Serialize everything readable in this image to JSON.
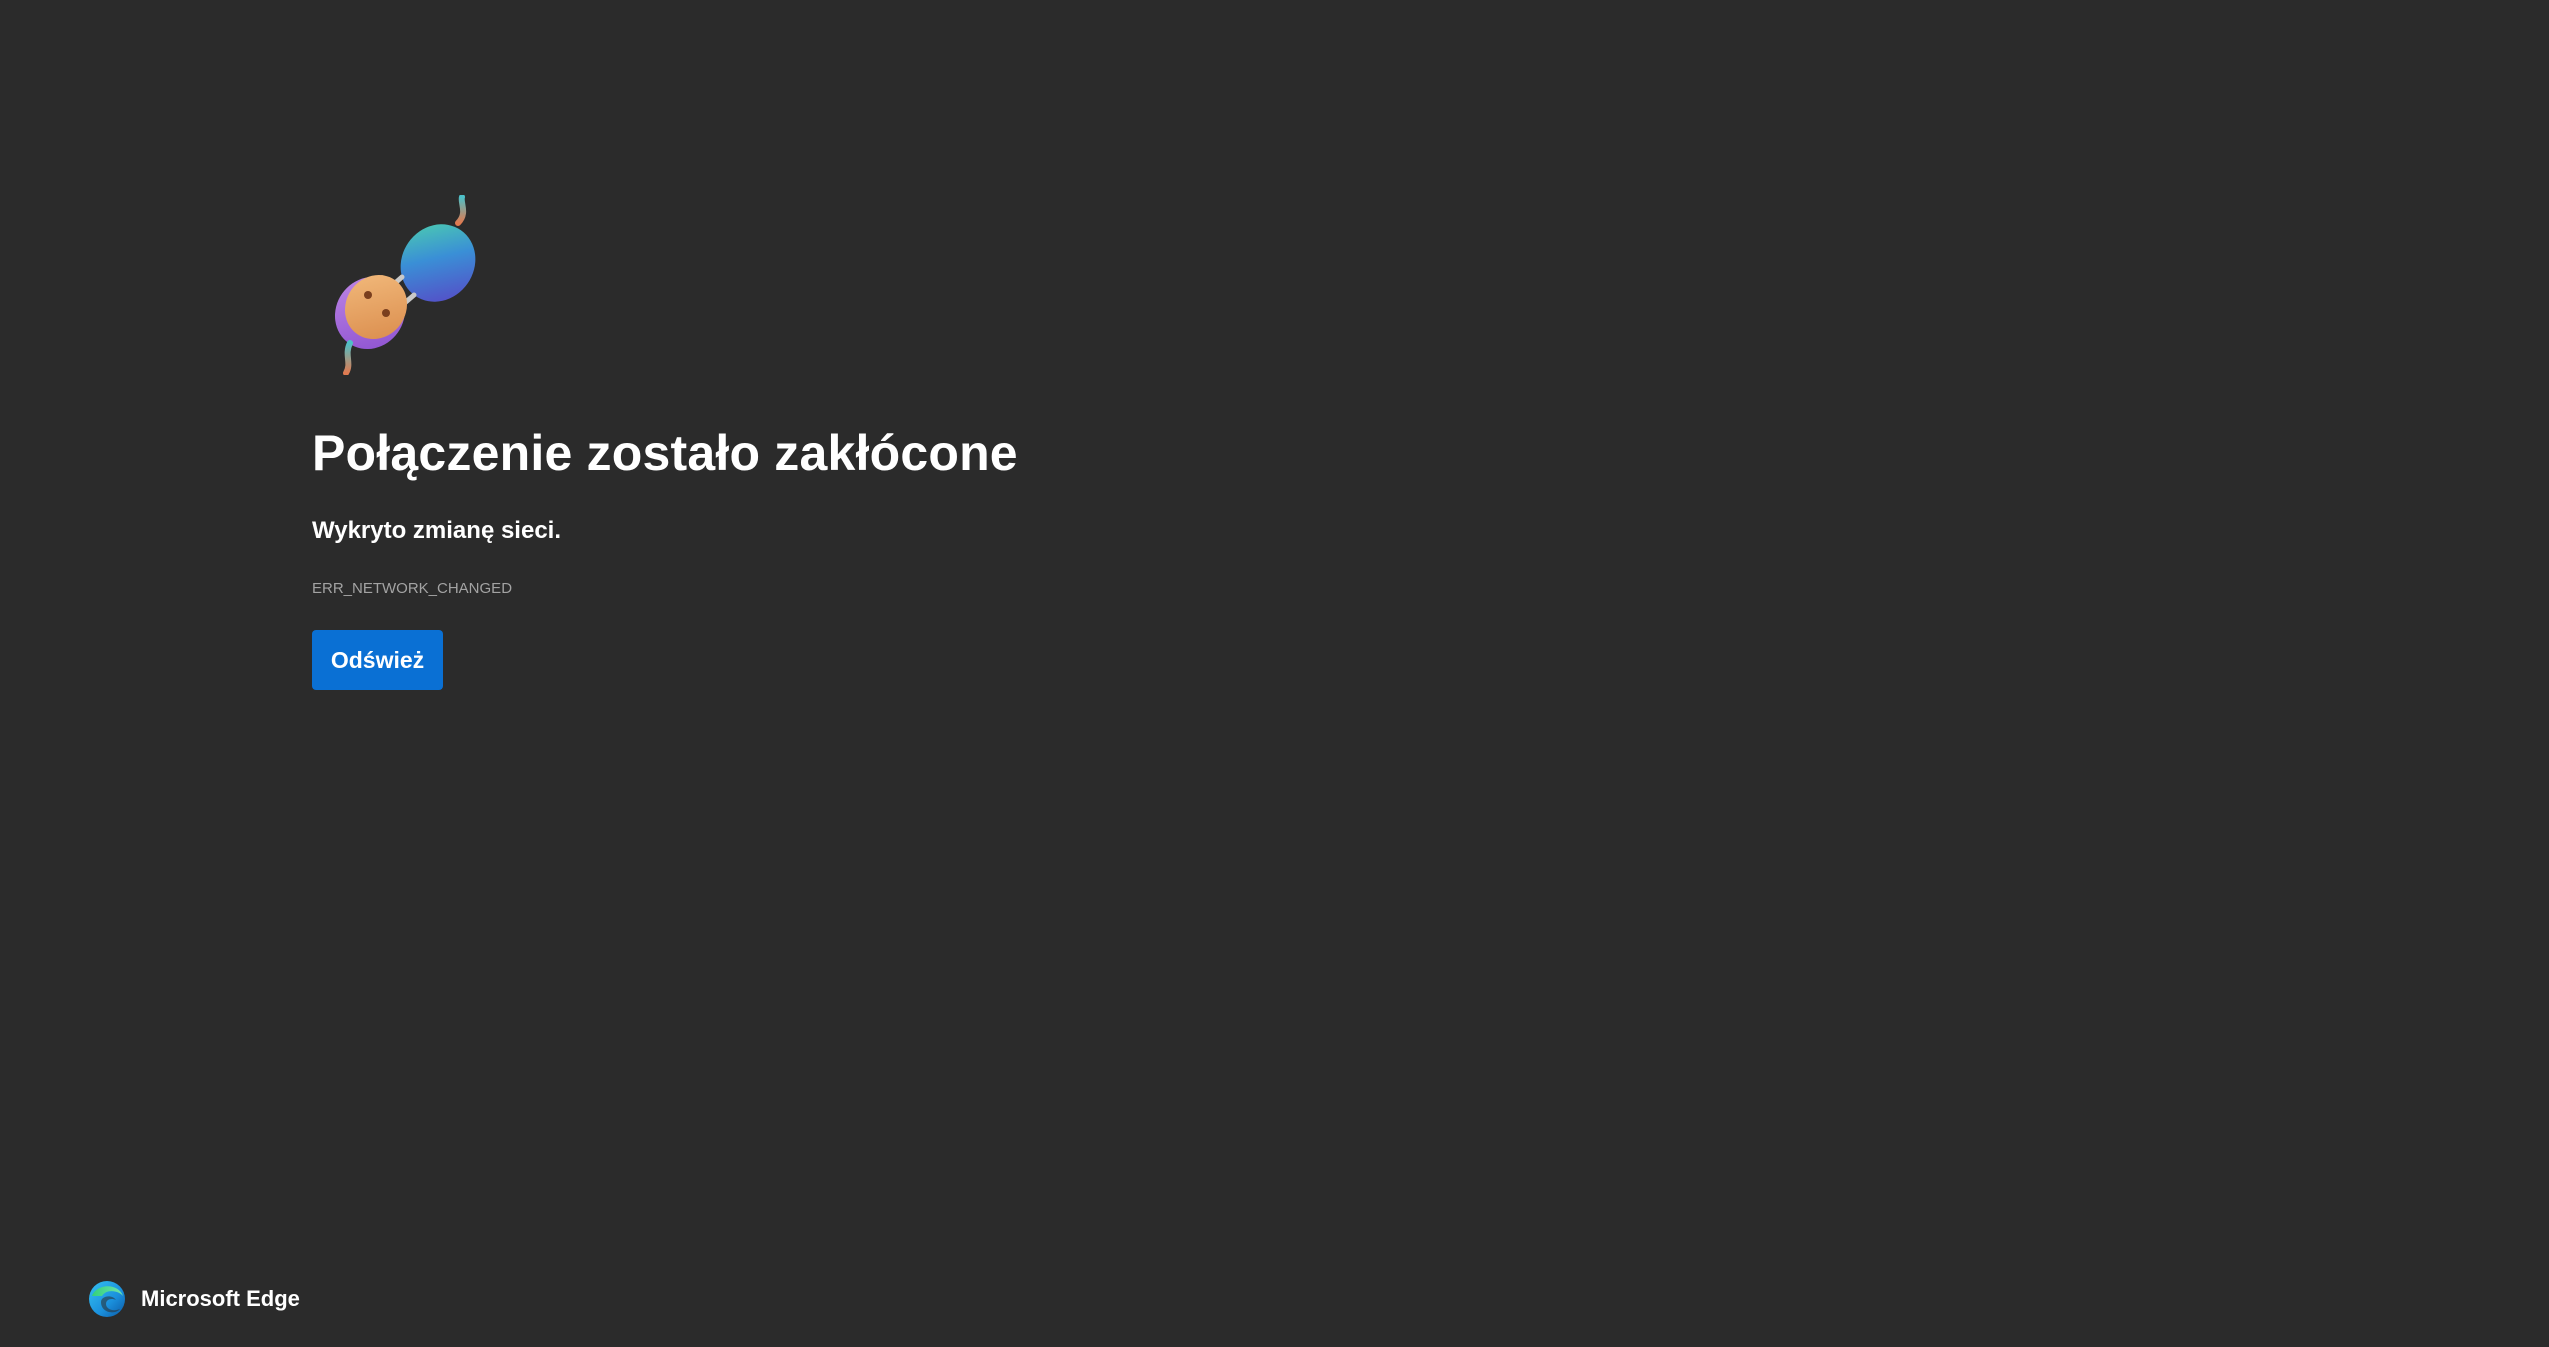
{
  "error_page": {
    "illustration_icon": "unplugged-cable-icon",
    "title": "Połączenie zostało zakłócone",
    "subtitle": "Wykryto zmianę sieci.",
    "error_code": "ERR_NETWORK_CHANGED",
    "refresh_label": "Odśwież",
    "button_color": "#0a70d4",
    "background_color": "#2b2b2b"
  },
  "footer": {
    "brand_icon": "edge-logo-icon",
    "brand_label": "Microsoft Edge"
  }
}
